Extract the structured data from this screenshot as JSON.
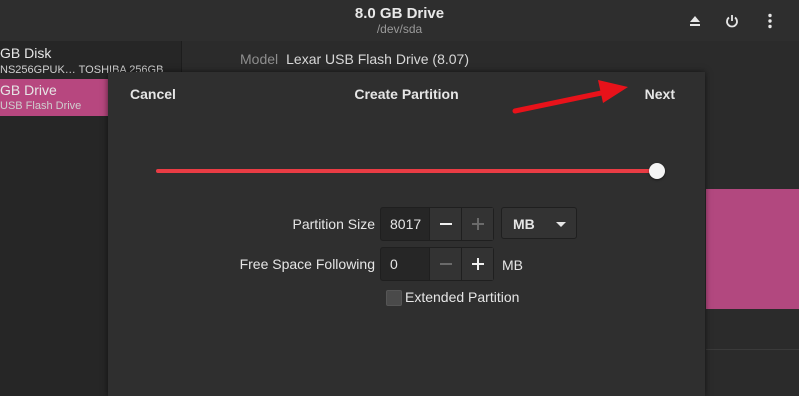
{
  "header": {
    "title": "8.0 GB Drive",
    "subtitle": "/dev/sda",
    "icons": [
      "eject-icon",
      "power-icon",
      "menu-dots-icon"
    ]
  },
  "sidebar": {
    "items": [
      {
        "name": "GB Disk",
        "desc": "NS256GPUK… TOSHIBA 256GB",
        "selected": false
      },
      {
        "name": "GB Drive",
        "desc": "USB Flash Drive",
        "selected": true
      }
    ]
  },
  "main": {
    "model_label": "Model",
    "model_value": "Lexar USB Flash Drive (8.07)"
  },
  "dialog": {
    "cancel_label": "Cancel",
    "title": "Create Partition",
    "next_label": "Next",
    "slider_fraction": 1.0,
    "partition_size_label": "Partition Size",
    "partition_size_value": "8017",
    "partition_unit": "MB",
    "free_space_label": "Free Space Following",
    "free_space_value": "0",
    "free_space_unit": "MB",
    "extended_label": "Extended Partition",
    "extended_checked": false
  },
  "colors": {
    "accent": "#e93c44",
    "selection": "#b7477f",
    "annotation_arrow": "#e8121a"
  }
}
